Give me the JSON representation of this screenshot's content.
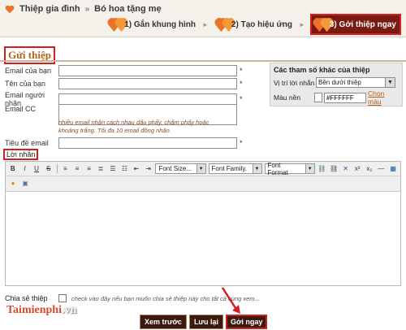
{
  "breadcrumb": {
    "section": "Thiệp gia đình",
    "separator": "»",
    "current": "Bó hoa tặng mẹ"
  },
  "steps": [
    {
      "label": "1) Gắn khung hình",
      "active": false
    },
    {
      "label": "2) Tạo hiệu ứng",
      "active": false
    },
    {
      "label": "3) Gởi thiệp ngay",
      "active": true
    }
  ],
  "step_separator": "►",
  "section_title": "Gửi thiệp",
  "form": {
    "sender_email_label": "Email của bạn",
    "sender_name_label": "Tên của bạn",
    "recipient_email_label": "Email người nhận",
    "cc_label": "Email CC",
    "cc_hint": "nhiều email nhận cách nhau dấu phẩy, chấm phẩy hoặc khoảng trắng. Tối đa 10 email đồng nhận.",
    "subject_label": "Tiêu đề email",
    "message_label": "Lời nhắn",
    "required_mark": "*",
    "share_label": "Chia sẻ thiệp",
    "share_note": "check vào đây nếu bạn muốn chia sẻ thiệp này cho tất cả cùng xem..."
  },
  "options_panel": {
    "title": "Các tham số khác của thiệp",
    "position_label": "Vị trí lời nhắn",
    "position_value": "Bên dưới thiệp",
    "bgcolor_label": "Màu nền",
    "bgcolor_value": "#FFFFFF",
    "pick_color_link": "Chọn màu"
  },
  "editor": {
    "font_size": "Font Size...",
    "font_family": "Font Family.",
    "font_format": "Font Format"
  },
  "buttons": {
    "preview": "Xem trước",
    "save": "Lưu lại",
    "send": "Gởi ngay"
  },
  "watermark": {
    "brand": "Taimienphi",
    "tld": ".vn"
  },
  "colors": {
    "accent_red": "#d21f1f",
    "button_bg": "#3c1a0e",
    "title_orange": "#b5621d"
  }
}
